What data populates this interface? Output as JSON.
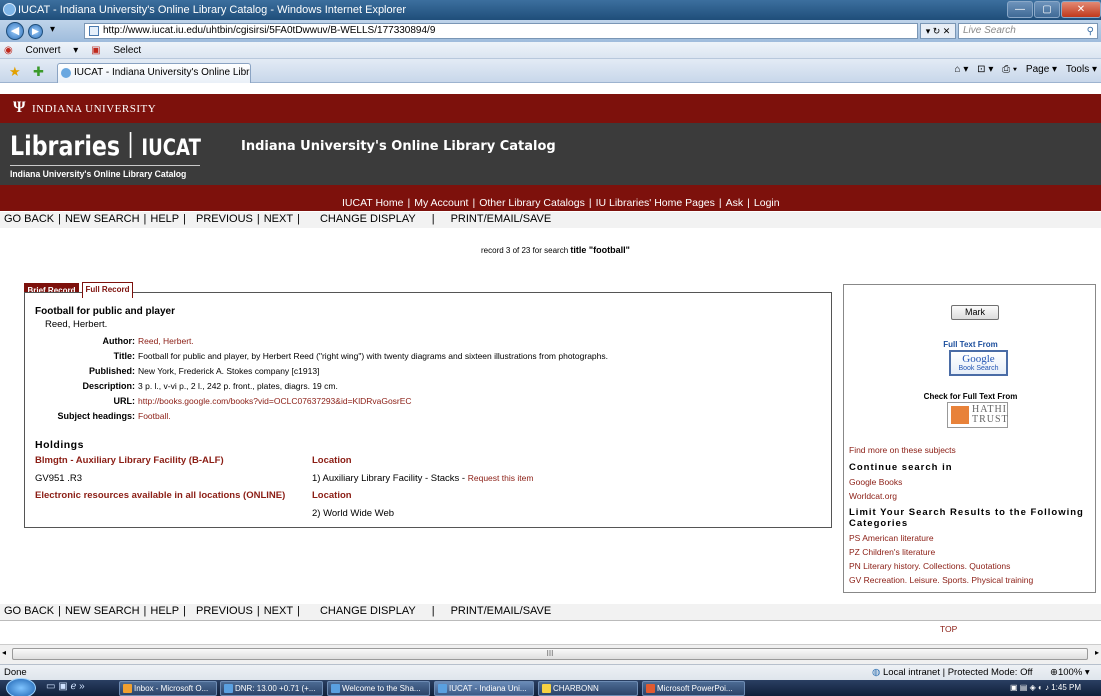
{
  "window": {
    "title": "IUCAT - Indiana University's Online Library Catalog - Windows Internet Explorer",
    "controls": [
      "—",
      "▢",
      "✕"
    ]
  },
  "browser": {
    "url": "http://www.iucat.iu.edu/uhtbin/cgisirsi/5FA0tDwwuv/B-WELLS/177330894/9",
    "search_placeholder": "Live Search",
    "convert_label": "Convert",
    "select_label": "Select",
    "tab_title": "IUCAT - Indiana University's Online Library Catalog",
    "commands": [
      "Page ▾",
      "Tools ▾"
    ],
    "status_text": "Done",
    "zone_text": "Local intranet | Protected Mode: Off",
    "zoom_text": "100%",
    "scroll_mark": "III"
  },
  "taskbar": {
    "items": [
      "Inbox - Microsoft O...",
      "DNR: 13.00 +0.71 (+...",
      "Welcome to the Sha...",
      "IUCAT - Indiana Uni...",
      "CHARBONN",
      "Microsoft PowerPoi..."
    ],
    "active_index": 3,
    "clock": "1:45 PM"
  },
  "header": {
    "university": "INDIANA UNIVERSITY",
    "libraries": "Libraries",
    "iucat": "IUCAT",
    "tagline": "Indiana University's Online Library Catalog",
    "catalog_title": "Indiana University's Online Library Catalog"
  },
  "top_nav": [
    "IUCAT Home",
    "My Account",
    "Other Library Catalogs",
    "IU Libraries' Home Pages",
    "Ask",
    "Login"
  ],
  "toolbar": {
    "go_back": "GO BACK",
    "new_search": "NEW SEARCH",
    "help": "HELP",
    "previous": "PREVIOUS",
    "next": "NEXT",
    "change_display": "CHANGE DISPLAY",
    "print": "PRINT/EMAIL/SAVE"
  },
  "record_info": {
    "prefix": "record 3 of 23 for search",
    "search": "title \"football\""
  },
  "record_tabs": {
    "brief": "Brief Record",
    "full": "Full Record"
  },
  "record": {
    "title": "Football for public and player",
    "author_line": "Reed, Herbert.",
    "fields": {
      "author_label": "Author:",
      "author_value": "Reed, Herbert.",
      "title_label": "Title:",
      "title_value": "Football for public and player, by Herbert Reed (\"right wing\") with twenty diagrams and sixteen illustrations from photographs.",
      "published_label": "Published:",
      "published_value": "New York, Frederick A. Stokes company [c1913]",
      "description_label": "Description:",
      "description_value": "3 p. l., v-vi p., 2 l., 242 p. front., plates, diagrs. 19 cm.",
      "url_label": "URL:",
      "url_value": "http://books.google.com/books?vid=OCLC07637293&id=KlDRvaGosrEC",
      "subject_label": "Subject headings:",
      "subject_value": "Football."
    }
  },
  "holdings": {
    "heading": "Holdings",
    "library1": "Blmgtn - Auxiliary Library Facility (B-ALF)",
    "location_label1": "Location",
    "call_number": "GV951 .R3",
    "location1": "1) Auxiliary Library Facility - Stacks -",
    "request_link": "Request this item",
    "library2": "Electronic resources available in all locations (ONLINE)",
    "location_label2": "Location",
    "location2": "2) World Wide Web"
  },
  "sidebar": {
    "mark_button": "Mark",
    "full_text_from": "Full Text From",
    "google_label": "Google",
    "google_sub": "Book Search",
    "check_full_text": "Check for Full Text From",
    "hathi_line1": "HATHI",
    "hathi_line2": "TRUST",
    "find_more": "Find more on these subjects",
    "continue_heading": "Continue search in",
    "continue_links": [
      "Google Books",
      "Worldcat.org"
    ],
    "limit_heading_1": "Limit Your Search Results to the Following",
    "limit_heading_2": "Categories",
    "category_links": [
      "PS American literature",
      "PZ Children's literature",
      "PN Literary history. Collections. Quotations",
      "GV Recreation. Leisure. Sports. Physical training"
    ]
  },
  "footer": {
    "top_link": "TOP"
  },
  "colors": {
    "iu_crimson": "#7d110c",
    "banner_gray": "#3b3b3b",
    "link_red": "#8b1d14",
    "google_blue": "#1a4d9c"
  }
}
